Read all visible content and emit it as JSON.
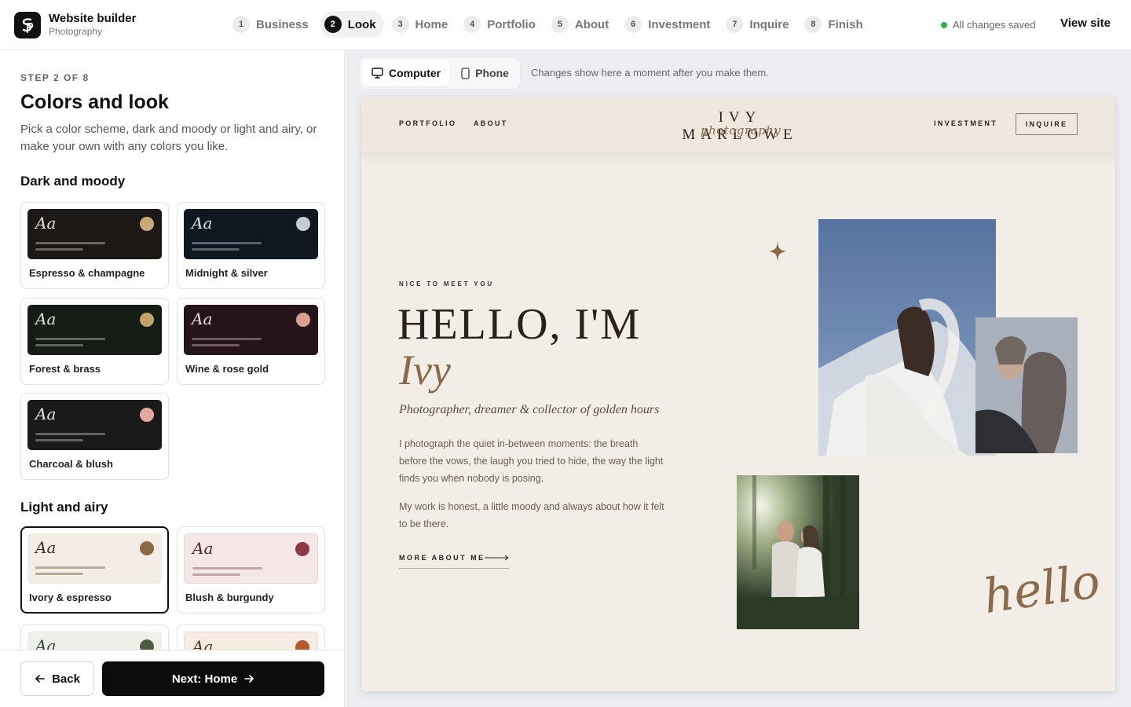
{
  "header": {
    "brand_title": "Website builder",
    "brand_sub": "Photography",
    "steps": [
      {
        "num": "1",
        "label": "Business"
      },
      {
        "num": "2",
        "label": "Look"
      },
      {
        "num": "3",
        "label": "Home"
      },
      {
        "num": "4",
        "label": "Portfolio"
      },
      {
        "num": "5",
        "label": "About"
      },
      {
        "num": "6",
        "label": "Investment"
      },
      {
        "num": "7",
        "label": "Inquire"
      },
      {
        "num": "8",
        "label": "Finish"
      }
    ],
    "active_step": 2,
    "saved_status": "All changes saved",
    "view_site": "View site"
  },
  "panel": {
    "kicker": "STEP 2 OF 8",
    "title": "Colors and look",
    "description": "Pick a color scheme, dark and moody or light and airy, or make your own with any colors you like.",
    "dark_title": "Dark and moody",
    "light_title": "Light and airy",
    "swatch_text": "Aa",
    "dark_themes": [
      {
        "name": "Espresso & champagne",
        "bg": "#1c1815",
        "text": "#e8dfd2",
        "dot": "#c9a97a",
        "line": "#6d645b"
      },
      {
        "name": "Midnight & silver",
        "bg": "#111720",
        "text": "#dde3ea",
        "dot": "#c3ccd6",
        "line": "#5b6370"
      },
      {
        "name": "Forest & brass",
        "bg": "#141c15",
        "text": "#e1e4d8",
        "dot": "#c2a466",
        "line": "#5e665a"
      },
      {
        "name": "Wine & rose gold",
        "bg": "#25141a",
        "text": "#ecd9d9",
        "dot": "#d9a092",
        "line": "#6f5a5e"
      },
      {
        "name": "Charcoal & blush",
        "bg": "#1a1a1a",
        "text": "#e9e3df",
        "dot": "#e6a8a2",
        "line": "#666262"
      }
    ],
    "light_themes": [
      {
        "name": "Ivory & espresso",
        "bg": "#f4ede6",
        "text": "#3a2f28",
        "dot": "#8b6a45",
        "line": "#b7a898",
        "selected": true
      },
      {
        "name": "Blush & burgundy",
        "bg": "#f5e7e7",
        "text": "#4a2a2e",
        "dot": "#8d3747",
        "line": "#bfa5a8",
        "selected": false
      },
      {
        "name": "",
        "bg": "#eef0ea",
        "text": "#38402f",
        "dot": "#4e5d3f",
        "line": "#b1b7a8",
        "selected": false
      },
      {
        "name": "",
        "bg": "#f6ece4",
        "text": "#4a3224",
        "dot": "#b45a2b",
        "line": "#c6ab98",
        "selected": false
      }
    ],
    "back_label": "Back",
    "next_label": "Next: Home"
  },
  "preview": {
    "device_computer": "Computer",
    "device_phone": "Phone",
    "active_device": "Computer",
    "hint": "Changes show here a moment after you make them.",
    "site": {
      "nav_portfolio": "PORTFOLIO",
      "nav_about": "ABOUT",
      "logo": "IVY MARLOWE",
      "logo_script": "photography",
      "nav_investment": "INVESTMENT",
      "nav_inquire": "INQUIRE",
      "kicker": "NICE TO MEET YOU",
      "headline": "HELLO, I'M",
      "name": "Ivy",
      "tagline": "Photographer, dreamer & collector of golden hours",
      "bio_1": "I photograph the quiet in-between moments: the breath before the vows, the laugh you tried to hide, the way the light finds you when nobody is posing.",
      "bio_2": "My work is honest, a little moody and always about how it felt to be there.",
      "more_link": "MORE ABOUT ME",
      "hello_script": "hello"
    }
  }
}
